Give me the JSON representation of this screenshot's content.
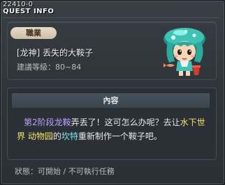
{
  "title": {
    "quest_id": "22410-0",
    "window_label": "QUEST INFO"
  },
  "info": {
    "job_badge": "職業",
    "quest_name": "[龙神]  丢失的大鞍子",
    "level_label": "建議等級：80~84"
  },
  "content": {
    "header": "內容",
    "parts": [
      {
        "text": "第2阶段龙鞍",
        "style": "purple"
      },
      {
        "text": "弄丢了！这可怎么办呢？去让",
        "style": "plain"
      },
      {
        "text": "水下世界",
        "style": "yellow"
      },
      {
        "text": " ",
        "style": "plain"
      },
      {
        "text": "动物园",
        "style": "yellow"
      },
      {
        "text": "的",
        "style": "plain"
      },
      {
        "text": "坎特",
        "style": "cyan"
      },
      {
        "text": "重新制作一个鞍子吧。",
        "style": "plain"
      }
    ]
  },
  "status": "狀態：可開始 / 不可執行任務",
  "colors": {
    "purple": "#b9a3ff",
    "yellow": "#f4e26b",
    "cyan": "#7fe6f2"
  },
  "npc": {
    "icon": "npc-portrait-mushroom-hat-kid"
  }
}
